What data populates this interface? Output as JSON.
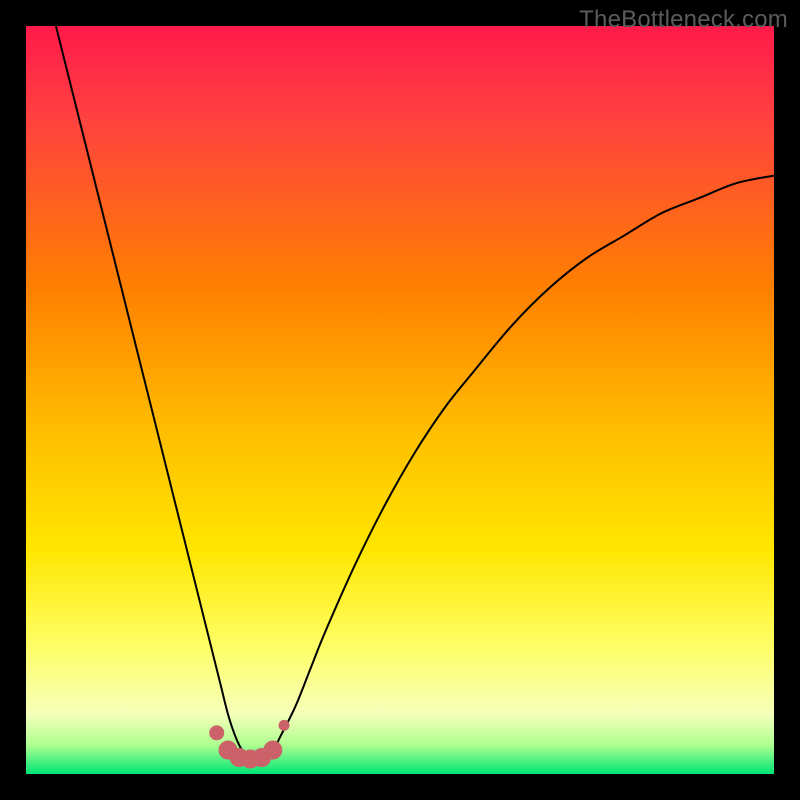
{
  "watermark": "TheBottleneck.com",
  "colors": {
    "black": "#000000",
    "curve": "#000000",
    "marker_fill": "#cb6269",
    "marker_stroke": "#cb6269",
    "grad_top": "#ff1a4b",
    "grad_1": "#ff4040",
    "grad_2": "#ff8000",
    "grad_3": "#ffc000",
    "grad_4": "#ffe600",
    "grad_5": "#ffff66",
    "grad_6": "#f5ffba",
    "grad_7": "#b0ff90",
    "grad_bottom": "#00e676"
  },
  "chart_data": {
    "type": "line",
    "title": "",
    "xlabel": "",
    "ylabel": "",
    "xlim": [
      0,
      100
    ],
    "ylim": [
      0,
      100
    ],
    "grid": false,
    "legend": false,
    "annotations": [],
    "series": [
      {
        "name": "bottleneck-curve",
        "x": [
          4,
          6,
          8,
          10,
          12,
          14,
          16,
          18,
          20,
          22,
          24,
          25,
          26,
          27,
          28,
          29,
          30,
          31,
          32,
          33,
          34,
          36,
          38,
          40,
          44,
          48,
          52,
          56,
          60,
          65,
          70,
          75,
          80,
          85,
          90,
          95,
          100
        ],
        "y": [
          100,
          92,
          84,
          76,
          68,
          60,
          52,
          44,
          36,
          28,
          20,
          16,
          12,
          8,
          5,
          3,
          2,
          2,
          2,
          3,
          5,
          9,
          14,
          19,
          28,
          36,
          43,
          49,
          54,
          60,
          65,
          69,
          72,
          75,
          77,
          79,
          80
        ]
      }
    ],
    "markers": {
      "name": "trough-markers",
      "x": [
        25.5,
        27,
        28.5,
        30,
        31.5,
        33,
        34.5
      ],
      "y": [
        5.5,
        3.2,
        2.2,
        2.0,
        2.2,
        3.2,
        6.5
      ],
      "sizes": [
        7,
        9,
        9,
        9,
        9,
        9,
        5
      ]
    }
  }
}
